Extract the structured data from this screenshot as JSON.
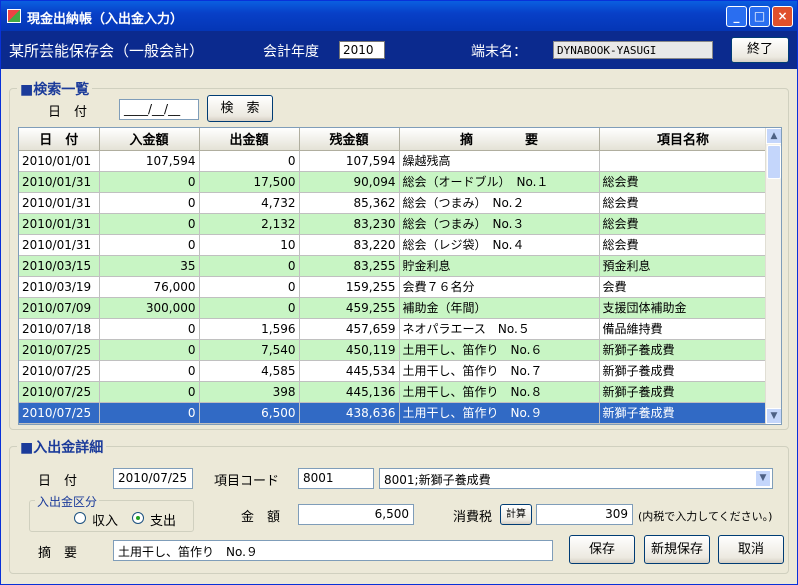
{
  "window": {
    "title": "現金出納帳（入出金入力）"
  },
  "header": {
    "org": "某所芸能保存会（一般会計）",
    "fiscal_year_label": "会計年度",
    "fiscal_year": "2010",
    "terminal_label": "端末名：",
    "terminal": "DYNABOOK-YASUGI",
    "exit_label": "終了"
  },
  "search": {
    "title": "■検索一覧",
    "date_label": "日　付",
    "date_value": "____/__/__",
    "search_label": "検　索"
  },
  "table": {
    "columns": [
      "日　付",
      "入金額",
      "出金額",
      "残金額",
      "摘　　　　要",
      "項目名称"
    ],
    "rows": [
      [
        "2010/01/01",
        "107,594",
        "0",
        "107,594",
        "繰越残高",
        ""
      ],
      [
        "2010/01/31",
        "0",
        "17,500",
        "90,094",
        "総会（オードブル）　No.１",
        "総会費"
      ],
      [
        "2010/01/31",
        "0",
        "4,732",
        "85,362",
        "総会（つまみ）　No.２",
        "総会費"
      ],
      [
        "2010/01/31",
        "0",
        "2,132",
        "83,230",
        "総会（つまみ）　No.３",
        "総会費"
      ],
      [
        "2010/01/31",
        "0",
        "10",
        "83,220",
        "総会（レジ袋）　No.４",
        "総会費"
      ],
      [
        "2010/03/15",
        "35",
        "0",
        "83,255",
        "貯金利息",
        "預金利息"
      ],
      [
        "2010/03/19",
        "76,000",
        "0",
        "159,255",
        "会費７６名分",
        "会費"
      ],
      [
        "2010/07/09",
        "300,000",
        "0",
        "459,255",
        "補助金（年間）",
        "支援団体補助金"
      ],
      [
        "2010/07/18",
        "0",
        "1,596",
        "457,659",
        "ネオパラエース　No.５",
        "備品維持費"
      ],
      [
        "2010/07/25",
        "0",
        "7,540",
        "450,119",
        "土用干し、笛作り　No.６",
        "新獅子養成費"
      ],
      [
        "2010/07/25",
        "0",
        "4,585",
        "445,534",
        "土用干し、笛作り　No.７",
        "新獅子養成費"
      ],
      [
        "2010/07/25",
        "0",
        "398",
        "445,136",
        "土用干し、笛作り　No.８",
        "新獅子養成費"
      ],
      [
        "2010/07/25",
        "0",
        "6,500",
        "438,636",
        "土用干し、笛作り　No.９",
        "新獅子養成費"
      ]
    ]
  },
  "detail": {
    "title": "■入出金詳細",
    "date_label": "日　付",
    "date": "2010/07/25",
    "code_label": "項目コード",
    "code": "8001",
    "code_select": "8001;新獅子養成費",
    "kubun_label": "入出金区分",
    "income_label": "収入",
    "expense_label": "支出",
    "amount_label": "金　額",
    "amount": "6,500",
    "tax_label": "消費税",
    "calc_label": "計算",
    "tax": "309",
    "tax_note": "(内税で入力してください。)",
    "memo_label": "摘　要",
    "memo": "土用干し、笛作り　No.９",
    "save_label": "保存",
    "new_save_label": "新規保存",
    "cancel_label": "取消"
  }
}
